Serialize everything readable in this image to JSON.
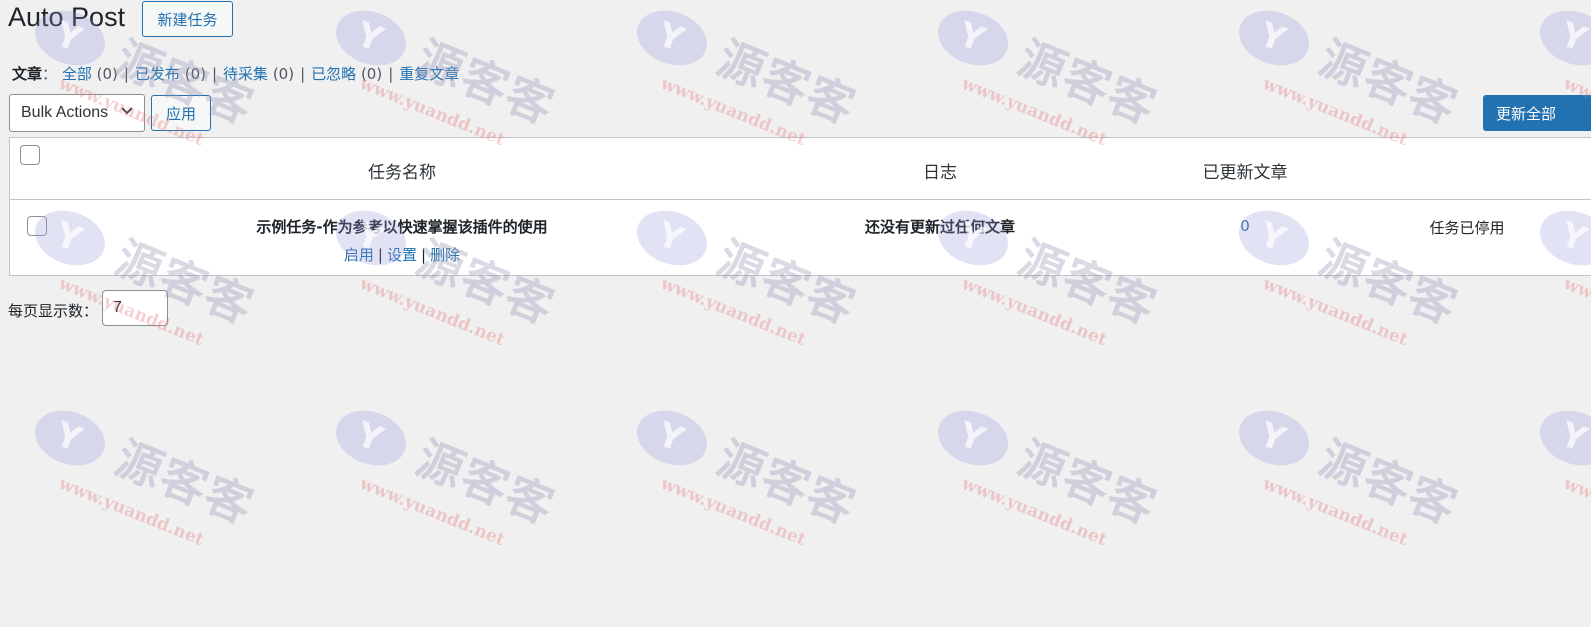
{
  "header": {
    "title": "Auto Post",
    "new_task_label": "新建任务"
  },
  "filters": {
    "label": "文章",
    "colon": "：",
    "items": [
      {
        "label": "全部",
        "count": "(0)"
      },
      {
        "label": "已发布",
        "count": "(0)"
      },
      {
        "label": "待采集",
        "count": "(0)"
      },
      {
        "label": "已忽略",
        "count": "(0)"
      },
      {
        "label": "重复文章",
        "count": ""
      }
    ],
    "separator": "|"
  },
  "toolbar": {
    "bulk_actions": "Bulk Actions",
    "apply_label": "应用",
    "update_all_label": "更新全部"
  },
  "table": {
    "columns": [
      "任务名称",
      "日志",
      "已更新文章"
    ],
    "rows": [
      {
        "name": "示例任务-作为参考以快速掌握该插件的使用",
        "actions": [
          "启用",
          "设置",
          "删除"
        ],
        "log": "还没有更新过任何文章",
        "updated_count": "0",
        "status": "任务已停用"
      }
    ]
  },
  "pagination": {
    "per_page_label": "每页显示数：",
    "per_page_value": "7"
  },
  "watermark": {
    "text": "源客客",
    "url": "www.yuandd.net"
  }
}
